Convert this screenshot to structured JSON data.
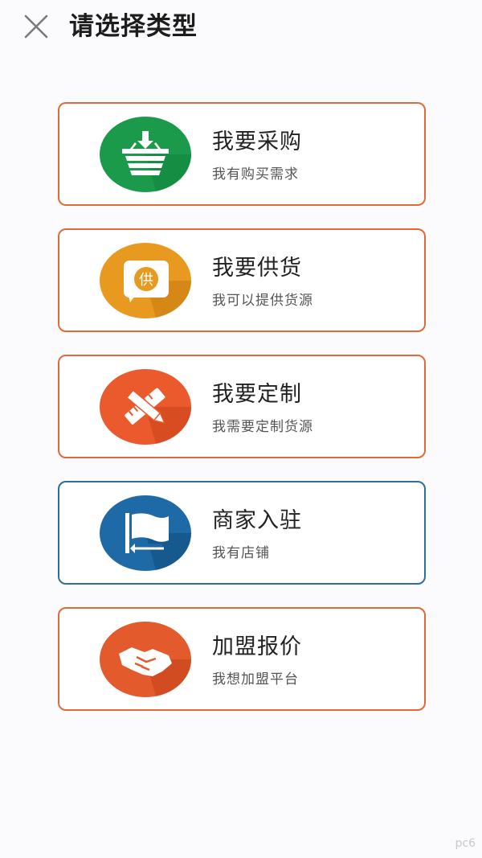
{
  "header": {
    "title": "请选择类型",
    "close_icon": "close-icon"
  },
  "cards": [
    {
      "title": "我要采购",
      "subtitle": "我有购买需求",
      "icon": "basket-icon",
      "color": "#1a9a4a",
      "border": "#e26a3a"
    },
    {
      "title": "我要供货",
      "subtitle": "我可以提供货源",
      "icon": "supply-icon",
      "color": "#e79a1f",
      "icon_text": "供",
      "border": "#e26a3a"
    },
    {
      "title": "我要定制",
      "subtitle": "我需要定制货源",
      "icon": "pencil-ruler-icon",
      "color": "#ea5a2c",
      "border": "#e26a3a"
    },
    {
      "title": "商家入驻",
      "subtitle": "我有店铺",
      "icon": "flag-icon",
      "color": "#1d6aa6",
      "border": "#2b6f9a"
    },
    {
      "title": "加盟报价",
      "subtitle": "我想加盟平台",
      "icon": "handshake-icon",
      "color": "#e35a2c",
      "border": "#e26a3a"
    }
  ],
  "watermark": "pc6"
}
